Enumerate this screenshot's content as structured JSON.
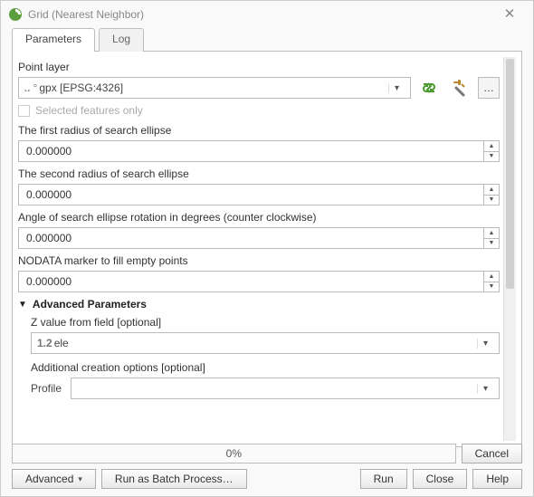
{
  "window": {
    "title": "Grid (Nearest Neighbor)"
  },
  "tabs": {
    "parameters": "Parameters",
    "log": "Log"
  },
  "params": {
    "point_layer_label": "Point layer",
    "layer_prefix": "᎑ °",
    "layer_value": "gpx [EPSG:4326]",
    "selected_only": "Selected features only",
    "radius1_label": "The first radius of search ellipse",
    "radius1_value": "0.000000",
    "radius2_label": "The second radius of search ellipse",
    "radius2_value": "0.000000",
    "angle_label": "Angle of search ellipse rotation in degrees (counter clockwise)",
    "angle_value": "0.000000",
    "nodata_label": "NODATA marker to fill empty points",
    "nodata_value": "0.000000"
  },
  "advanced": {
    "heading": "Advanced Parameters",
    "zfield_label": "Z value from field [optional]",
    "zfield_prefix": "1.2",
    "zfield_value": "ele",
    "addopt_label": "Additional creation options [optional]",
    "profile_label": "Profile"
  },
  "progress": {
    "text": "0%"
  },
  "buttons": {
    "cancel": "Cancel",
    "advanced": "Advanced",
    "batch": "Run as Batch Process…",
    "run": "Run",
    "close": "Close",
    "help": "Help"
  }
}
